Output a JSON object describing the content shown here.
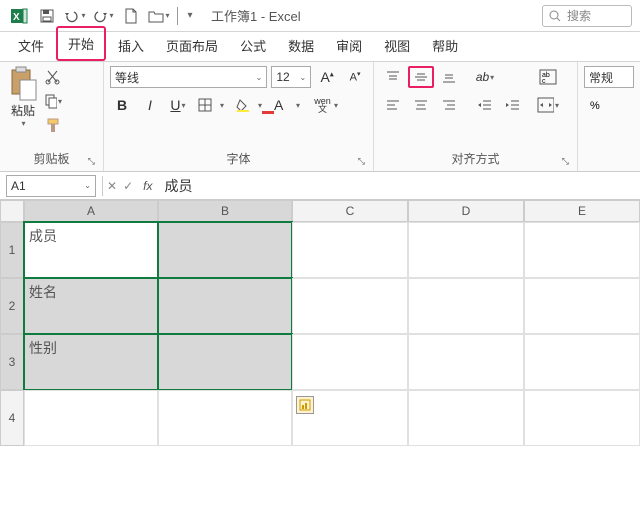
{
  "titlebar": {
    "doc": "工作簿1",
    "app": "Excel",
    "search_placeholder": "搜索"
  },
  "tabs": [
    "文件",
    "开始",
    "插入",
    "页面布局",
    "公式",
    "数据",
    "审阅",
    "视图",
    "帮助"
  ],
  "active_tab": 1,
  "ribbon": {
    "clipboard": {
      "paste": "粘贴",
      "label": "剪贴板"
    },
    "font": {
      "name": "等线",
      "size": "12",
      "label": "字体",
      "bold": "B",
      "italic": "I",
      "underline": "U",
      "wen": "wen\n文"
    },
    "align": {
      "label": "对齐方式"
    },
    "number": {
      "style": "常规"
    }
  },
  "namebox": "A1",
  "formula": "成员",
  "columns": [
    "A",
    "B",
    "C",
    "D",
    "E"
  ],
  "rows": [
    "1",
    "2",
    "3",
    "4"
  ],
  "cells": {
    "A1": "成员",
    "A2": "姓名",
    "A3": "性别"
  }
}
